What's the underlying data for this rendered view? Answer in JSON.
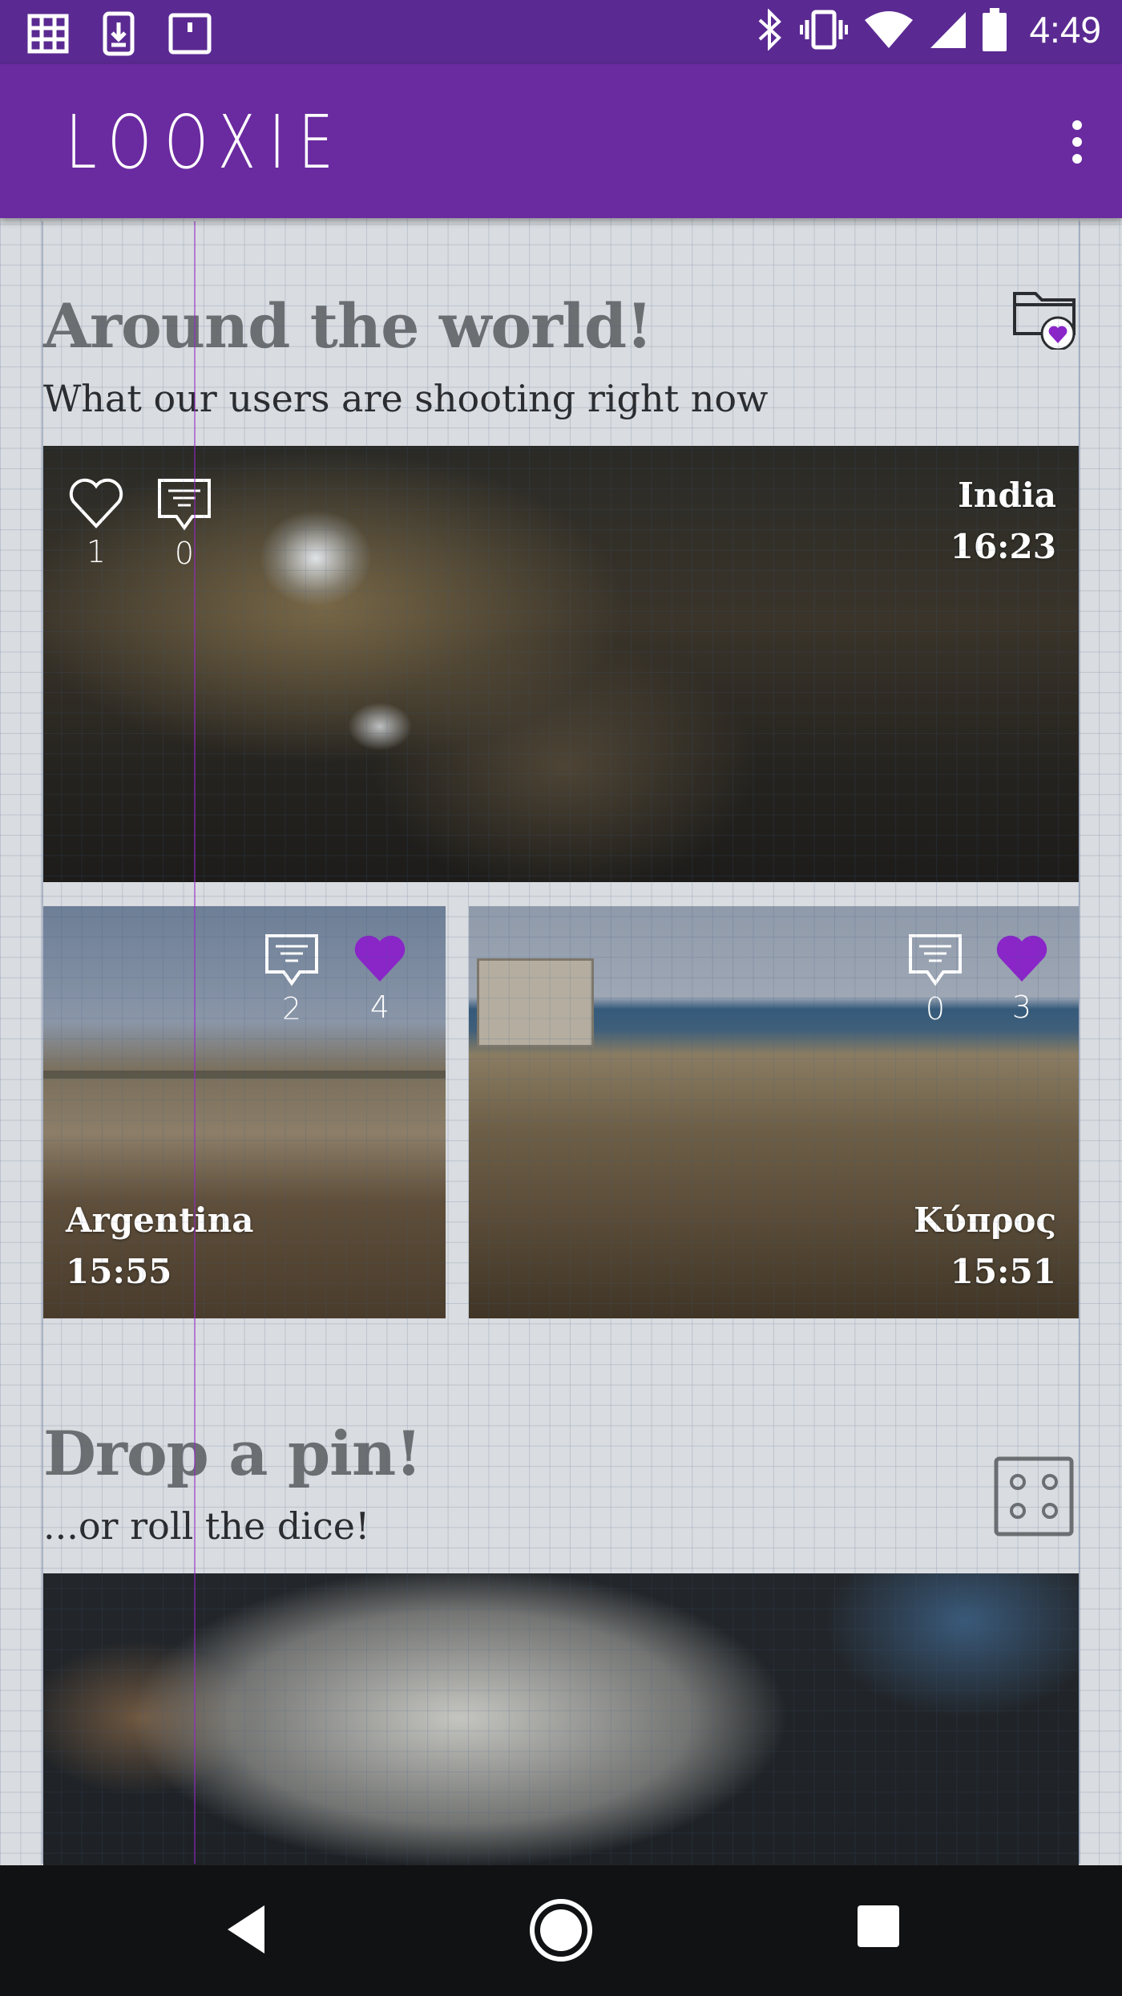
{
  "status_bar": {
    "time": "4:49",
    "left_icons": [
      "grid-icon",
      "download-icon",
      "notification-icon"
    ],
    "right_icons": [
      "bluetooth-icon",
      "vibrate-icon",
      "wifi-icon",
      "signal-icon",
      "battery-icon"
    ]
  },
  "app_bar": {
    "title": "LOOXIE",
    "menu_icon": "overflow-menu-icon"
  },
  "section_world": {
    "title": "Around the world!",
    "subtitle": "What our users are shooting right now",
    "action_icon": "favorite-folder-icon"
  },
  "photos": [
    {
      "location": "India",
      "time": "16:23",
      "likes": "1",
      "comments": "0",
      "liked": false
    },
    {
      "location": "Argentina",
      "time": "15:55",
      "likes": "4",
      "comments": "2",
      "liked": true
    },
    {
      "location": "Κύπρος",
      "time": "15:51",
      "likes": "3",
      "comments": "0",
      "liked": true
    }
  ],
  "section_pin": {
    "title": "Drop a pin!",
    "subtitle": "...or roll the dice!",
    "action_icon": "dice-icon"
  },
  "nav_bar": {
    "icons": [
      "back-icon",
      "home-icon",
      "recents-icon"
    ]
  },
  "colors": {
    "status_bar": "#5a2a92",
    "app_bar": "#6a2aa0",
    "accent_heart": "#8a25c8",
    "background": "#d9dce0"
  }
}
